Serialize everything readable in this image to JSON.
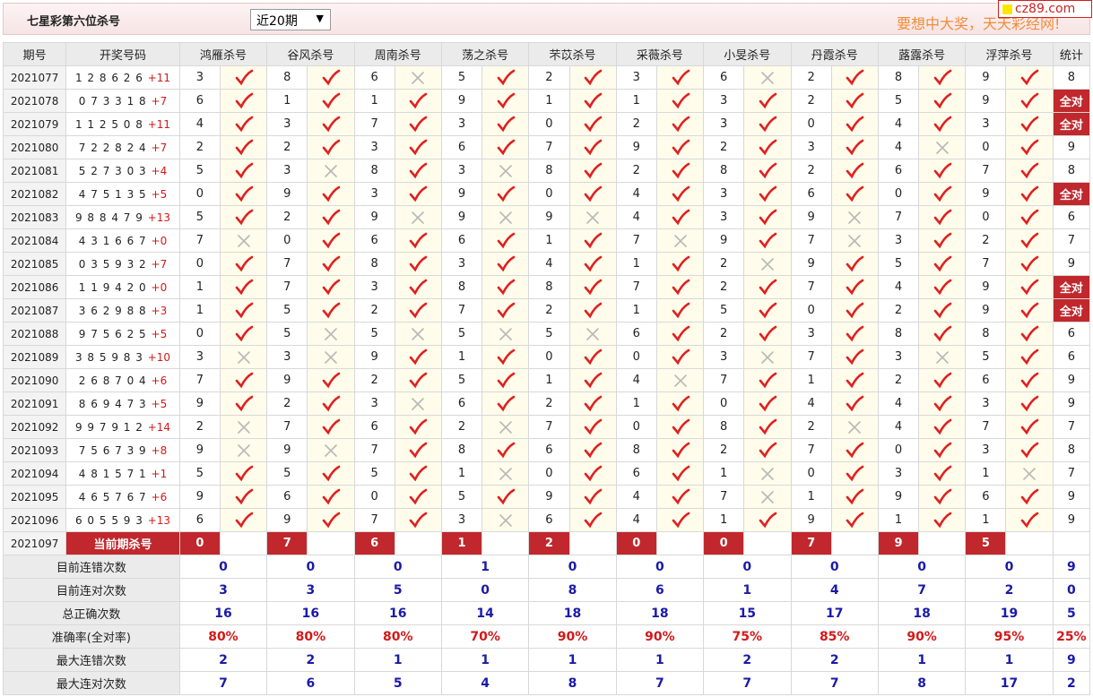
{
  "header": {
    "title": "七星彩第六位杀号",
    "period_select": "近20期",
    "slogan": "要想中大奖，天天彩经网!",
    "logo": "cz89.com"
  },
  "columns": {
    "period": "期号",
    "draw": "开奖号码",
    "experts": [
      "鸿雁杀号",
      "谷风杀号",
      "周南杀号",
      "荡之杀号",
      "芣苡杀号",
      "采薇杀号",
      "小旻杀号",
      "丹霞杀号",
      "蕗露杀号",
      "浮萍杀号"
    ],
    "stat": "统计"
  },
  "rows": [
    {
      "period": "2021077",
      "draw": "1 2 8 6 2 6",
      "sum": "+11",
      "kills": [
        3,
        8,
        6,
        5,
        2,
        3,
        6,
        2,
        8,
        9
      ],
      "marks": [
        1,
        1,
        0,
        1,
        1,
        1,
        0,
        1,
        1,
        1
      ],
      "stat": "8"
    },
    {
      "period": "2021078",
      "draw": "0 7 3 3 1 8",
      "sum": "+7",
      "kills": [
        6,
        1,
        1,
        9,
        1,
        1,
        3,
        2,
        5,
        9
      ],
      "marks": [
        1,
        1,
        1,
        1,
        1,
        1,
        1,
        1,
        1,
        1
      ],
      "stat": "全对"
    },
    {
      "period": "2021079",
      "draw": "1 1 2 5 0 8",
      "sum": "+11",
      "kills": [
        4,
        3,
        7,
        3,
        0,
        2,
        3,
        0,
        4,
        3
      ],
      "marks": [
        1,
        1,
        1,
        1,
        1,
        1,
        1,
        1,
        1,
        1
      ],
      "stat": "全对"
    },
    {
      "period": "2021080",
      "draw": "7 2 2 8 2 4",
      "sum": "+7",
      "kills": [
        2,
        2,
        3,
        6,
        7,
        9,
        2,
        3,
        4,
        0
      ],
      "marks": [
        1,
        1,
        1,
        1,
        1,
        1,
        1,
        1,
        0,
        1
      ],
      "stat": "9"
    },
    {
      "period": "2021081",
      "draw": "5 2 7 3 0 3",
      "sum": "+4",
      "kills": [
        5,
        3,
        8,
        3,
        8,
        2,
        8,
        2,
        6,
        7
      ],
      "marks": [
        1,
        0,
        1,
        0,
        1,
        1,
        1,
        1,
        1,
        1
      ],
      "stat": "8"
    },
    {
      "period": "2021082",
      "draw": "4 7 5 1 3 5",
      "sum": "+5",
      "kills": [
        0,
        9,
        3,
        9,
        0,
        4,
        3,
        6,
        0,
        9
      ],
      "marks": [
        1,
        1,
        1,
        1,
        1,
        1,
        1,
        1,
        1,
        1
      ],
      "stat": "全对"
    },
    {
      "period": "2021083",
      "draw": "9 8 8 4 7 9",
      "sum": "+13",
      "kills": [
        5,
        2,
        9,
        9,
        9,
        4,
        3,
        9,
        7,
        0
      ],
      "marks": [
        1,
        1,
        0,
        0,
        0,
        1,
        1,
        0,
        1,
        1
      ],
      "stat": "6"
    },
    {
      "period": "2021084",
      "draw": "4 3 1 6 6 7",
      "sum": "+0",
      "kills": [
        7,
        0,
        6,
        6,
        1,
        7,
        9,
        7,
        3,
        2
      ],
      "marks": [
        0,
        1,
        1,
        1,
        1,
        0,
        1,
        0,
        1,
        1
      ],
      "stat": "7"
    },
    {
      "period": "2021085",
      "draw": "0 3 5 9 3 2",
      "sum": "+7",
      "kills": [
        0,
        7,
        8,
        3,
        4,
        1,
        2,
        9,
        5,
        7
      ],
      "marks": [
        1,
        1,
        1,
        1,
        1,
        1,
        0,
        1,
        1,
        1
      ],
      "stat": "9"
    },
    {
      "period": "2021086",
      "draw": "1 1 9 4 2 0",
      "sum": "+0",
      "kills": [
        1,
        7,
        3,
        8,
        8,
        7,
        2,
        7,
        4,
        9
      ],
      "marks": [
        1,
        1,
        1,
        1,
        1,
        1,
        1,
        1,
        1,
        1
      ],
      "stat": "全对"
    },
    {
      "period": "2021087",
      "draw": "3 6 2 9 8 8",
      "sum": "+3",
      "kills": [
        1,
        5,
        2,
        7,
        2,
        1,
        5,
        0,
        2,
        9
      ],
      "marks": [
        1,
        1,
        1,
        1,
        1,
        1,
        1,
        1,
        1,
        1
      ],
      "stat": "全对"
    },
    {
      "period": "2021088",
      "draw": "9 7 5 6 2 5",
      "sum": "+5",
      "kills": [
        0,
        5,
        5,
        5,
        5,
        6,
        2,
        3,
        8,
        8
      ],
      "marks": [
        1,
        0,
        0,
        0,
        0,
        1,
        1,
        1,
        1,
        1
      ],
      "stat": "6"
    },
    {
      "period": "2021089",
      "draw": "3 8 5 9 8 3",
      "sum": "+10",
      "kills": [
        3,
        3,
        9,
        1,
        0,
        0,
        3,
        7,
        3,
        5
      ],
      "marks": [
        0,
        0,
        1,
        1,
        1,
        1,
        0,
        1,
        0,
        1
      ],
      "stat": "6"
    },
    {
      "period": "2021090",
      "draw": "2 6 8 7 0 4",
      "sum": "+6",
      "kills": [
        7,
        9,
        2,
        5,
        1,
        4,
        7,
        1,
        2,
        6
      ],
      "marks": [
        1,
        1,
        1,
        1,
        1,
        0,
        1,
        1,
        1,
        1
      ],
      "stat": "9"
    },
    {
      "period": "2021091",
      "draw": "8 6 9 4 7 3",
      "sum": "+5",
      "kills": [
        9,
        2,
        3,
        6,
        2,
        1,
        0,
        4,
        4,
        3
      ],
      "marks": [
        1,
        1,
        0,
        1,
        1,
        1,
        1,
        1,
        1,
        1
      ],
      "stat": "9"
    },
    {
      "period": "2021092",
      "draw": "9 9 7 9 1 2",
      "sum": "+14",
      "kills": [
        2,
        7,
        6,
        2,
        7,
        0,
        8,
        2,
        4,
        7
      ],
      "marks": [
        0,
        1,
        1,
        0,
        1,
        1,
        1,
        0,
        1,
        1
      ],
      "stat": "7"
    },
    {
      "period": "2021093",
      "draw": "7 5 6 7 3 9",
      "sum": "+8",
      "kills": [
        9,
        9,
        7,
        8,
        6,
        8,
        2,
        7,
        0,
        3
      ],
      "marks": [
        0,
        0,
        1,
        1,
        1,
        1,
        1,
        1,
        1,
        1
      ],
      "stat": "8"
    },
    {
      "period": "2021094",
      "draw": "4 8 1 5 7 1",
      "sum": "+1",
      "kills": [
        5,
        5,
        5,
        1,
        0,
        6,
        1,
        0,
        3,
        1
      ],
      "marks": [
        1,
        1,
        1,
        0,
        1,
        1,
        0,
        1,
        1,
        0
      ],
      "stat": "7"
    },
    {
      "period": "2021095",
      "draw": "4 6 5 7 6 7",
      "sum": "+6",
      "kills": [
        9,
        6,
        0,
        5,
        9,
        4,
        7,
        1,
        9,
        6
      ],
      "marks": [
        1,
        1,
        1,
        1,
        1,
        1,
        0,
        1,
        1,
        1
      ],
      "stat": "9"
    },
    {
      "period": "2021096",
      "draw": "6 0 5 5 9 3",
      "sum": "+13",
      "kills": [
        6,
        9,
        7,
        3,
        6,
        4,
        1,
        9,
        1,
        1
      ],
      "marks": [
        1,
        1,
        1,
        0,
        1,
        1,
        1,
        1,
        1,
        1
      ],
      "stat": "9"
    }
  ],
  "current": {
    "period": "2021097",
    "label": "当前期杀号",
    "kills": [
      0,
      7,
      6,
      1,
      2,
      0,
      0,
      7,
      9,
      5
    ]
  },
  "summary": [
    {
      "label": "目前连错次数",
      "values": [
        0,
        0,
        0,
        1,
        0,
        0,
        0,
        0,
        0,
        0
      ],
      "stat": "9",
      "style": "val"
    },
    {
      "label": "目前连对次数",
      "values": [
        3,
        3,
        5,
        0,
        8,
        6,
        1,
        4,
        7,
        2
      ],
      "stat": "0",
      "style": "val"
    },
    {
      "label": "总正确次数",
      "values": [
        16,
        16,
        16,
        14,
        18,
        18,
        15,
        17,
        18,
        19
      ],
      "stat": "5",
      "style": "val"
    },
    {
      "label": "准确率(全对率)",
      "values": [
        "80%",
        "80%",
        "80%",
        "70%",
        "90%",
        "90%",
        "75%",
        "85%",
        "90%",
        "95%"
      ],
      "stat": "25%",
      "style": "pct"
    },
    {
      "label": "最大连错次数",
      "values": [
        2,
        2,
        1,
        1,
        1,
        1,
        2,
        2,
        1,
        1
      ],
      "stat": "9",
      "style": "val"
    },
    {
      "label": "最大连对次数",
      "values": [
        7,
        6,
        5,
        4,
        8,
        7,
        7,
        7,
        8,
        17
      ],
      "stat": "2",
      "style": "val"
    }
  ],
  "colors": {
    "accent": "#c0282d",
    "check": "#e02020",
    "cross": "#b8b8b8",
    "sum_value": "#1a1aa8"
  }
}
